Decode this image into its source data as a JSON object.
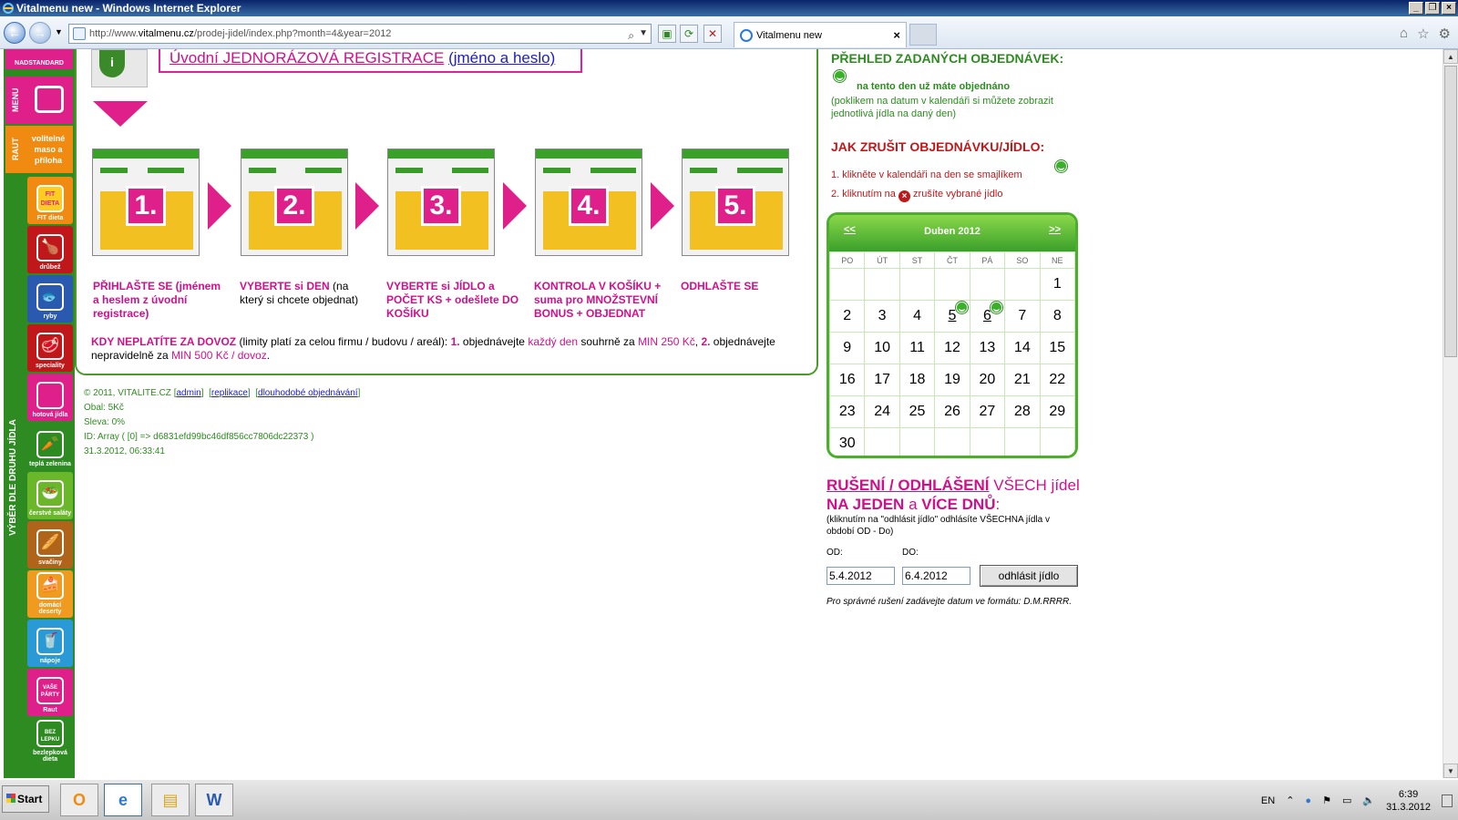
{
  "window": {
    "title": "Vitalmenu new - Windows Internet Explorer"
  },
  "browser": {
    "url_prefix": "http://www.",
    "url_domain": "vitalmenu.cz",
    "url_rest": "/prodej-jidel/index.php?month=4&year=2012",
    "tab_label": "Vitalmenu new"
  },
  "sidebar": {
    "price_label": "NADSTANDARD",
    "vert_menu": "MENU",
    "vert_raut": "RAUT",
    "optional": "volitelné maso a příloha",
    "vert_choice": "VÝBĚR DLE DRUHU JÍDLA",
    "items": [
      {
        "label": "FIT dieta",
        "badge": "FIT DIETA"
      },
      {
        "label": "drůbež"
      },
      {
        "label": "ryby"
      },
      {
        "label": "speciality"
      },
      {
        "label": "hotová jídla"
      },
      {
        "label": "teplá zelenina"
      },
      {
        "label": "čerstvé saláty"
      },
      {
        "label": "svačiny"
      },
      {
        "label": "domácí deserty"
      },
      {
        "label": "nápoje"
      },
      {
        "label": "Raut",
        "badge": "VAŠE PÁRTY"
      },
      {
        "label": "bezlepková dieta",
        "badge": "BEZ LEPKU"
      }
    ]
  },
  "main": {
    "registration_text": "Úvodní JEDNORÁZOVÁ REGISTRACE",
    "registration_link": "(jméno a heslo)",
    "steps": [
      {
        "num": "1.",
        "bold": "PŘIHLAŠTE SE (jménem a heslem z úvodní registrace)",
        "normal": ""
      },
      {
        "num": "2.",
        "bold": "VYBERTE si DEN",
        "normal": " (na který si chcete objednat)"
      },
      {
        "num": "3.",
        "bold": "VYBERTE si JÍDLO a POČET KS + odešlete DO KOŠÍKU",
        "normal": ""
      },
      {
        "num": "4.",
        "bold": "KONTROLA V KOŠÍKU + suma pro MNOŽSTEVNÍ BONUS + OBJEDNAT",
        "normal": ""
      },
      {
        "num": "5.",
        "bold": "ODHLAŠTE SE",
        "normal": ""
      }
    ],
    "note": {
      "title": "KDY NEPLATÍTE ZA DOVOZ",
      "t1": " (limity platí za celou firmu / budovu / areál): ",
      "n1": "1.",
      "t2": " objednávejte ",
      "p1": "každý den",
      "t3": " souhrně za ",
      "p2": "MIN 250 Kč",
      "t4": ", ",
      "n2": "2.",
      "t5": " objednávejte nepravidelně za ",
      "p3": "MIN 500 Kč / dovoz",
      "t6": "."
    }
  },
  "footer": {
    "copyright": "© 2011, VITALITE.CZ",
    "admin": "admin",
    "replikace": "replikace",
    "long": "dlouhodobé objednávání",
    "obal": "Obal: 5Kč",
    "sleva": "Sleva: 0%",
    "id": "ID: Array ( [0] => d6831efd99bc46df856cc7806dc22373 )",
    "datetime": "31.3.2012, 06:33:41"
  },
  "right": {
    "overview_title": "PŘEHLED ZADANÝCH OBJEDNÁVEK:",
    "ordered_text": "na tento den už máte objednáno",
    "ordered_hint": "(poklikem na datum v kalendáři si můžete zobrazit jednotlivá jídla na daný den)",
    "cancel_title": "JAK ZRUŠIT OBJEDNÁVKU/JÍDLO:",
    "cancel_1": "1. klikněte v kalendáři na den se smajlíkem",
    "cancel_2a": "2. kliknutím na",
    "cancel_2b": "zrušíte vybrané jídlo"
  },
  "calendar": {
    "prev": "<<",
    "next": ">>",
    "title": "Duben 2012",
    "weekdays": [
      "PO",
      "ÚT",
      "ST",
      "ČT",
      "PÁ",
      "SO",
      "NE"
    ],
    "weeks": [
      [
        "",
        "",
        "",
        "",
        "",
        "",
        "1"
      ],
      [
        "2",
        "3",
        "4",
        "5",
        "6",
        "7",
        "8"
      ],
      [
        "9",
        "10",
        "11",
        "12",
        "13",
        "14",
        "15"
      ],
      [
        "16",
        "17",
        "18",
        "19",
        "20",
        "21",
        "22"
      ],
      [
        "23",
        "24",
        "25",
        "26",
        "27",
        "28",
        "29"
      ],
      [
        "30",
        "",
        "",
        "",
        "",
        "",
        ""
      ]
    ],
    "ordered_days": [
      "5",
      "6"
    ]
  },
  "bulk_cancel": {
    "h_u1": "RUŠENÍ / ODHLÁŠENÍ",
    "h_n1": " VŠECH jídel ",
    "h_b1": "NA JEDEN",
    "h_n2": " a ",
    "h_b2": "VÍCE DNŮ",
    "h_n3": ":",
    "sub": "(kliknutím na \"odhlásit jídlo\" odhlásíte VŠECHNA jídla v období OD - Do)",
    "od_label": "OD:",
    "do_label": "DO:",
    "od_value": "5.4.2012",
    "do_value": "6.4.2012",
    "button": "odhlásit jídlo",
    "note": "Pro správné rušení zadávejte datum ve formátu: D.M.RRRR."
  },
  "taskbar": {
    "start": "Start",
    "lang": "EN",
    "time": "6:39",
    "date": "31.3.2012"
  },
  "colors": {
    "green": "#2e8b22",
    "pink": "#d0108a",
    "red": "#c0181a"
  }
}
